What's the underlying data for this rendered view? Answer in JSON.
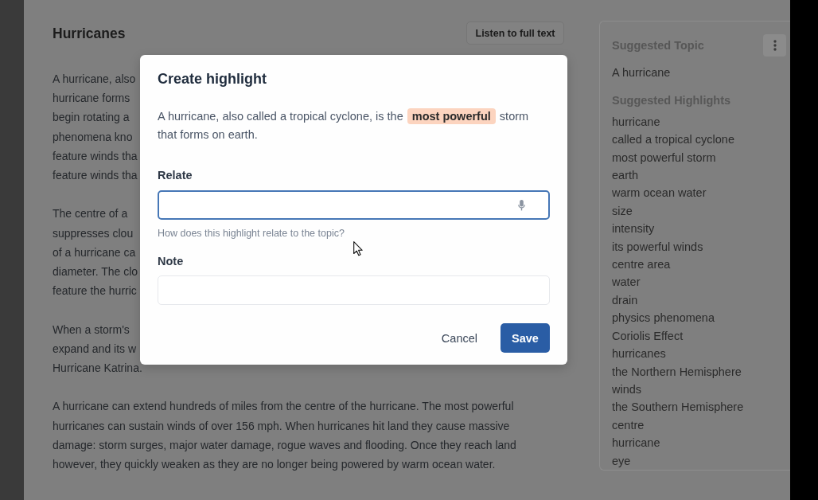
{
  "article": {
    "title": "Hurricanes",
    "listen_button": "Listen to full text",
    "paragraphs": [
      [
        "A hurricane, also",
        "hurricane forms",
        "begin rotating a",
        "phenomena kno",
        "feature winds tha",
        "feature winds tha"
      ],
      [
        "The centre of a",
        "suppresses clou",
        "of a hurricane ca",
        "diameter. The clo",
        "feature the hurric"
      ],
      [
        "When a storm's",
        "expand and its w",
        "Hurricane Katrina."
      ],
      [
        "A hurricane can extend hundreds of miles from the centre of the hurricane. The most powerful",
        "hurricanes can sustain winds of over 156 mph. When hurricanes hit land they cause massive",
        "damage: storm surges, major water damage, rogue waves and flooding. Once they reach land",
        "however, they quickly weaken as they are no longer being powered by warm ocean water."
      ]
    ]
  },
  "sidebar": {
    "topic_heading": "Suggested Topic",
    "topic": "A hurricane",
    "highlights_heading": "Suggested Highlights",
    "highlights": [
      "hurricane",
      "called a tropical cyclone",
      "most powerful storm",
      "earth",
      "warm ocean water",
      "size",
      "intensity",
      "its powerful winds",
      "centre area",
      "water",
      "drain",
      "physics phenomena",
      "Coriolis Effect",
      "hurricanes",
      "the Northern Hemisphere",
      "winds",
      "the Southern Hemisphere",
      "centre",
      "hurricane",
      "eye"
    ]
  },
  "dialog": {
    "title": "Create highlight",
    "quote": {
      "before": "A hurricane, also called a tropical cyclone, is the ",
      "highlight": "most powerful",
      "after": " storm that forms on earth."
    },
    "fields": [
      {
        "label": "Relate",
        "kind": "voice",
        "focused": true,
        "help_text": "How does this highlight relate to the topic?"
      },
      {
        "label": "Note",
        "kind": "text",
        "focused": false
      }
    ],
    "buttons": [
      {
        "label": "Cancel",
        "kind": "secondary"
      },
      {
        "label": "Save",
        "kind": "primary"
      }
    ]
  }
}
